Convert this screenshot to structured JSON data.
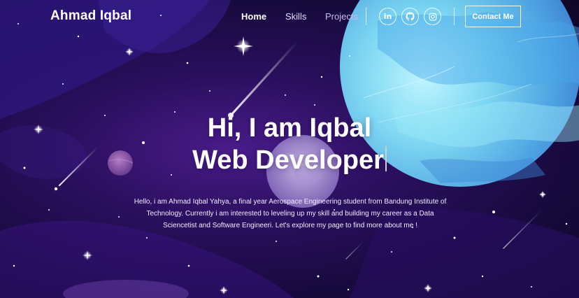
{
  "nav": {
    "brand": "Ahmad Iqbal",
    "links": [
      {
        "label": "Home"
      },
      {
        "label": "Skills"
      },
      {
        "label": "Projects"
      }
    ],
    "social": [
      {
        "icon": "linkedin-icon",
        "text": "in"
      },
      {
        "icon": "github-icon"
      },
      {
        "icon": "instagram-icon"
      }
    ],
    "contact_label": "Contact Me"
  },
  "hero": {
    "line1": "Hi, I am Iqbal",
    "line2": "Web Developer",
    "intro": "Hello, i am Ahmad Iqbal Yahya, a final year Aerospace Engineering student from Bandung Institute of Technology. Currently i am interested to leveling up my skill and building my career as a Data Sciencetist and Software Engineeri. Let's explore my page to find more about me !"
  },
  "colors": {
    "space_dark": "#170a3d",
    "space_purple": "#4a1c8a",
    "planet_light": "#8fe3f5",
    "planet_dark": "#3f86d8"
  }
}
